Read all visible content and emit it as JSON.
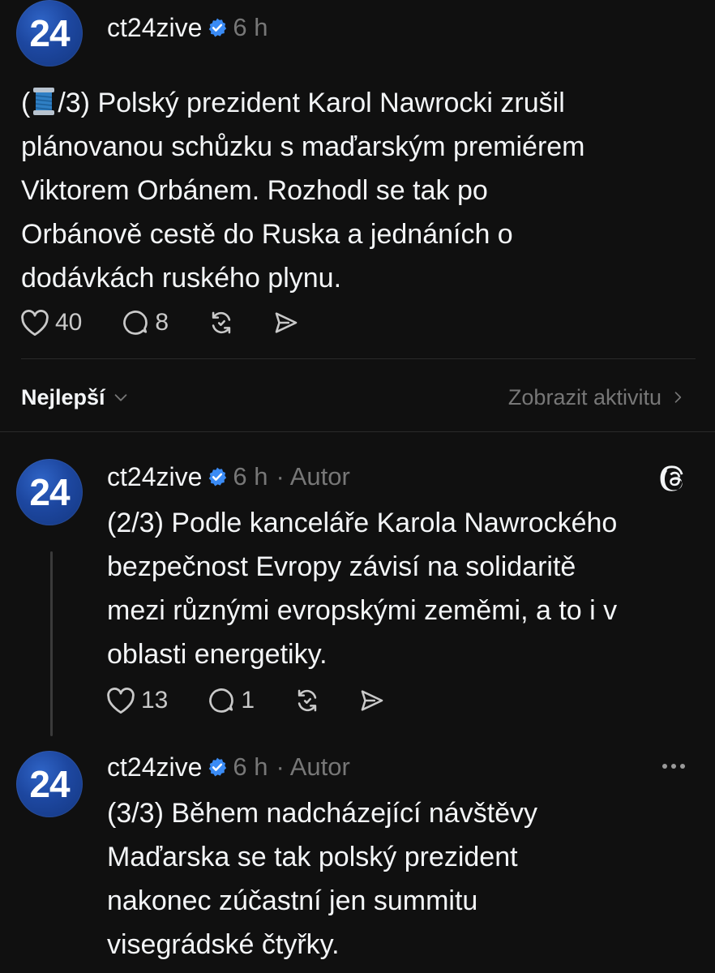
{
  "main_post": {
    "avatar_text": "24",
    "handle": "ct24zive",
    "time": "6 h",
    "thread_prefix_open": "(",
    "text_after_emoji": "/3) Polský prezident Karol Nawrocki zrušil",
    "lines": [
      "plánovanou schůzku s maďarským premiérem",
      "Viktorem Orbánem. Rozhodl se tak po",
      "Orbánově cestě do Ruska a jednáních o",
      "dodávkách ruského plynu."
    ],
    "likes": "40",
    "replies": "8"
  },
  "sort_bar": {
    "sort_label": "Nejlepší",
    "activity_link": "Zobrazit aktivitu"
  },
  "reply_1": {
    "avatar_text": "24",
    "handle": "ct24zive",
    "time": "6 h",
    "author_tag": "· Autor",
    "lines": [
      "(2/3) Podle kanceláře Karola Nawrockého",
      "bezpečnost Evropy závisí na solidaritě",
      "mezi různými evropskými zeměmi, a to i v",
      "oblasti energetiky."
    ],
    "likes": "13",
    "replies": "1"
  },
  "reply_2": {
    "avatar_text": "24",
    "handle": "ct24zive",
    "time": "6 h",
    "author_tag": "· Autor",
    "lines": [
      "(3/3) Během nadcházející návštěvy",
      "Maďarska se tak polský prezident",
      "nakonec zúčastní jen summitu",
      "visegrádské čtyřky."
    ]
  },
  "icons": {
    "verified": "verified-badge-icon",
    "heart": "heart-icon",
    "comment": "comment-icon",
    "repost": "repost-icon",
    "share": "share-icon",
    "threads_logo": "threads-logo-icon",
    "more": "more-icon",
    "chevron_down": "chevron-down-icon",
    "chevron_right": "chevron-right-icon",
    "spool_emoji": "thread-spool-icon"
  },
  "colors": {
    "background": "#101010",
    "text": "#f3f5f7",
    "muted": "#777777",
    "verified_blue": "#3a8bf5",
    "avatar_blue": "#1d47a0"
  }
}
